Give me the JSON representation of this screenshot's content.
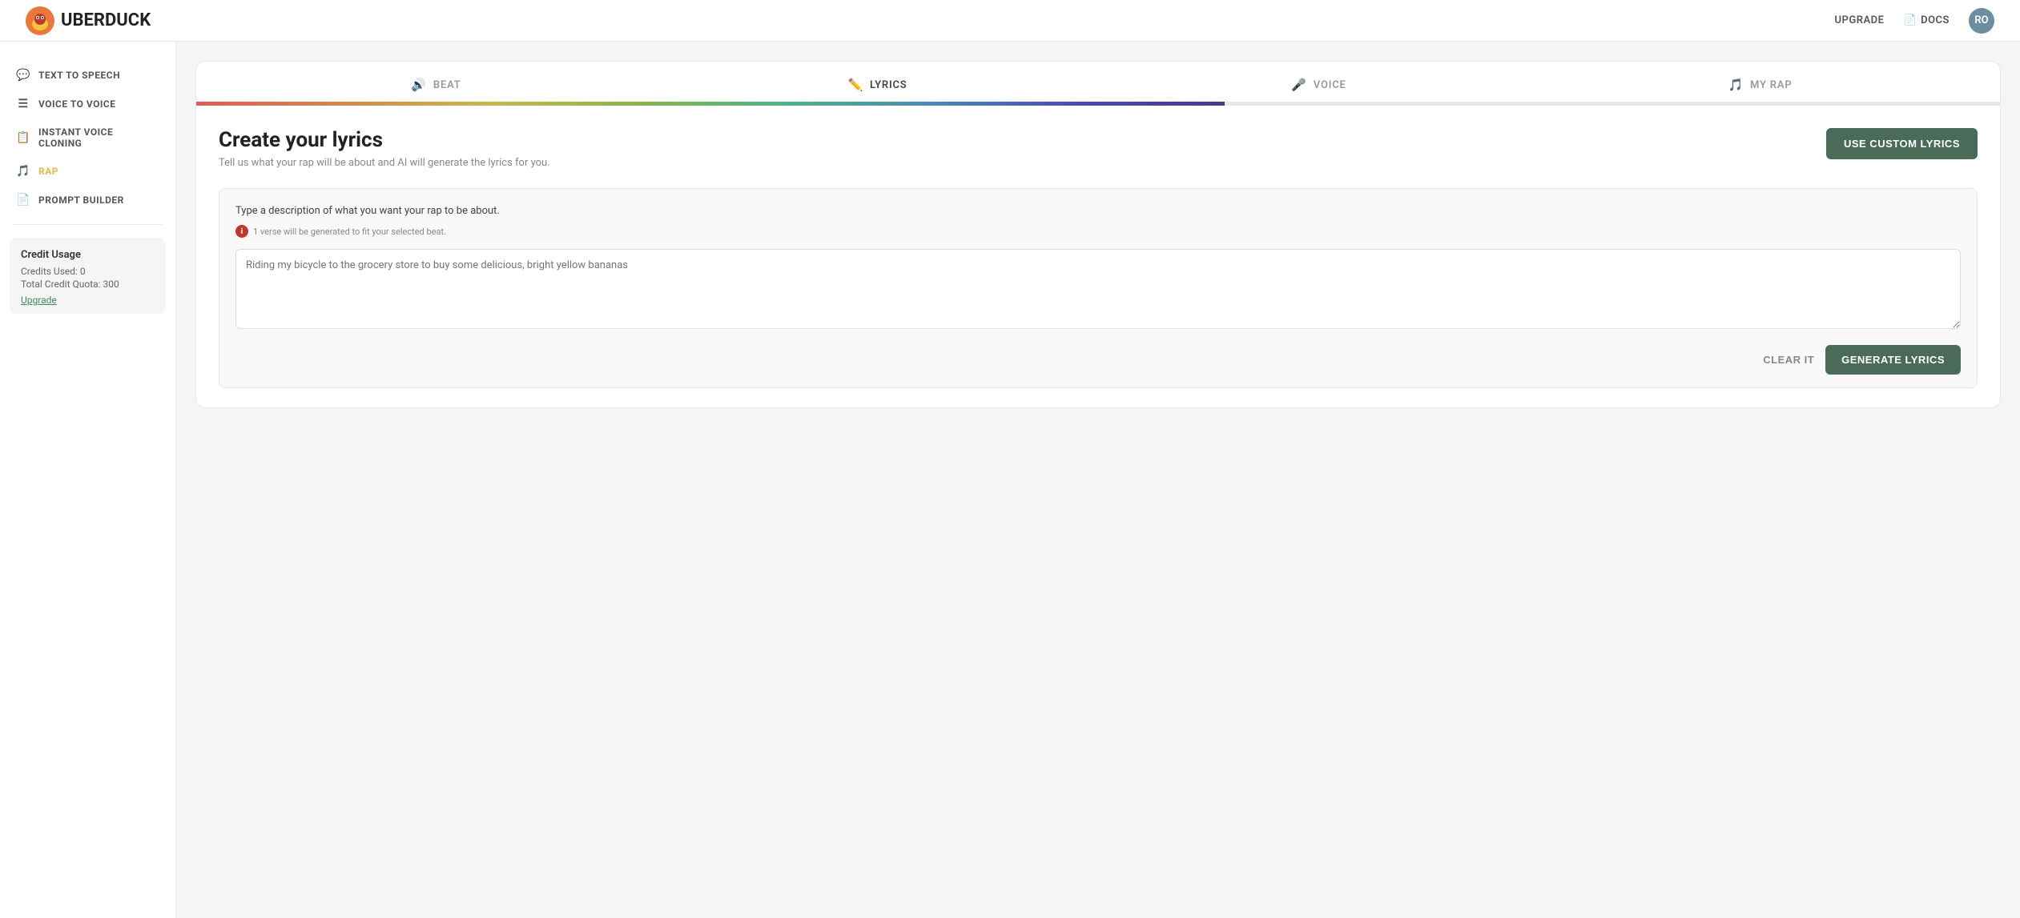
{
  "header": {
    "logo_text": "UBERDUCK",
    "upgrade_label": "UPGRADE",
    "docs_label": "DOCS",
    "avatar_initials": "RO"
  },
  "sidebar": {
    "items": [
      {
        "id": "text-to-speech",
        "label": "TEXT TO SPEECH",
        "icon": "💬"
      },
      {
        "id": "voice-to-voice",
        "label": "VOICE TO VOICE",
        "icon": "☰"
      },
      {
        "id": "instant-voice-cloning",
        "label": "INSTANT VOICE CLONING",
        "icon": "📋"
      },
      {
        "id": "rap",
        "label": "RAP",
        "icon": "🎵",
        "active": true
      },
      {
        "id": "prompt-builder",
        "label": "PROMPT BUILDER",
        "icon": "📄"
      }
    ],
    "credit_usage": {
      "title": "Credit Usage",
      "credits_used_label": "Credits Used: 0",
      "total_quota_label": "Total Credit Quota: 300",
      "upgrade_link": "Upgrade"
    }
  },
  "tabs": [
    {
      "id": "beat",
      "label": "BEAT",
      "icon": "🔊"
    },
    {
      "id": "lyrics",
      "label": "LYRICS",
      "icon": "✏️",
      "active": true
    },
    {
      "id": "voice",
      "label": "VOICE",
      "icon": "🎤"
    },
    {
      "id": "my-rap",
      "label": "MY RAP",
      "icon": "🎵"
    }
  ],
  "progress": {
    "percent": 57
  },
  "lyrics_panel": {
    "title": "Create your lyrics",
    "subtitle": "Tell us what your rap will be about and AI will generate the lyrics for you.",
    "use_custom_lyrics_btn": "USE CUSTOM LYRICS",
    "form": {
      "label": "Type a description of what you want your rap to be about.",
      "hint": "1 verse will be generated to fit your selected beat.",
      "placeholder": "Riding my bicycle to the grocery store to buy some delicious, bright yellow bananas",
      "clear_btn": "CLEAR IT",
      "generate_btn": "GENERATE LYRICS"
    }
  }
}
